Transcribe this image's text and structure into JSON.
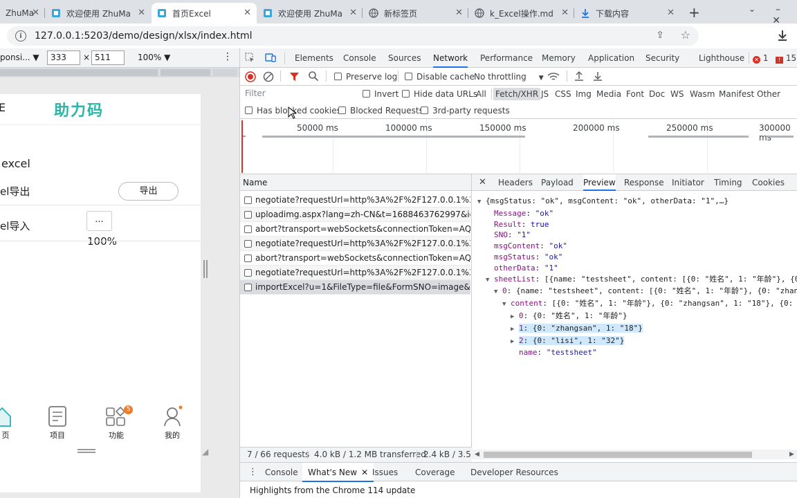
{
  "browser": {
    "tabs": [
      {
        "title": "ZhuMa",
        "icon": "app-icon",
        "active": false
      },
      {
        "title": "欢迎使用 ZhuMa",
        "icon": "app-icon",
        "active": false
      },
      {
        "title": "首页Excel",
        "icon": "app-icon",
        "active": true
      },
      {
        "title": "欢迎使用 ZhuMa",
        "icon": "app-icon",
        "active": false
      },
      {
        "title": "新标签页",
        "icon": "globe-icon",
        "active": false
      },
      {
        "title": "k_Excel操作.md",
        "icon": "globe-icon",
        "active": false
      },
      {
        "title": "下载内容",
        "icon": "download-icon",
        "active": false
      }
    ],
    "url": "127.0.0.1:5203/demo/design/xlsx/index.html"
  },
  "device_toolbar": {
    "mode": "ponsi...",
    "width": "333",
    "times": "×",
    "height": "511",
    "zoom": "100%"
  },
  "app": {
    "title_fragment": "E",
    "logo": "助力码",
    "section": "excel",
    "export_label": "el导出",
    "export_button": "导出",
    "import_label": "el导入",
    "import_button": "...",
    "progress": "100%",
    "nav": [
      {
        "label": "页",
        "icon": "home-icon"
      },
      {
        "label": "项目",
        "icon": "document-icon"
      },
      {
        "label": "功能",
        "icon": "grid-icon",
        "badge": "5"
      },
      {
        "label": "我的",
        "icon": "user-icon"
      }
    ]
  },
  "devtools": {
    "tabs": [
      "Elements",
      "Console",
      "Sources",
      "Network",
      "Performance",
      "Memory",
      "Application",
      "Security",
      "Lighthouse"
    ],
    "active_tab": "Network",
    "errors": "1",
    "warnings": "15",
    "preserve_log": "Preserve log",
    "disable_cache": "Disable cache",
    "throttling": "No throttling",
    "filter_placeholder": "Filter",
    "invert": "Invert",
    "hide_data_urls": "Hide data URLs",
    "type_filters": [
      "All",
      "Fetch/XHR",
      "JS",
      "CSS",
      "Img",
      "Media",
      "Font",
      "Doc",
      "WS",
      "Wasm",
      "Manifest",
      "Other"
    ],
    "active_filter": "Fetch/XHR",
    "blocked_cookies": "Has blocked cookies",
    "blocked_requests": "Blocked Requests",
    "third_party": "3rd-party requests",
    "timeline_ticks": [
      "50000 ms",
      "100000 ms",
      "150000 ms",
      "200000 ms",
      "250000 ms",
      "300000 ms"
    ],
    "name_header": "Name",
    "requests": [
      "negotiate?requestUrl=http%3A%2F%2F127.0.0.1%3A520...",
      "uploadimg.aspx?lang=zh-CN&t=1688463762997&id=d...",
      "abort?transport=webSockets&connectionToken=AQAA...",
      "negotiate?requestUrl=http%3A%2F%2F127.0.0.1%3A520...",
      "abort?transport=webSockets&connectionToken=AQAA...",
      "negotiate?requestUrl=http%3A%2F%2F127.0.0.1%3A520...",
      "importExcel?u=1&FileType=file&FormSNO=image&CdS..."
    ],
    "detail_tabs": [
      "Headers",
      "Payload",
      "Preview",
      "Response",
      "Initiator",
      "Timing",
      "Cookies"
    ],
    "active_detail_tab": "Preview",
    "preview": [
      {
        "indent": 0,
        "arrow": "▼",
        "key": "",
        "text": "{msgStatus: \"ok\", msgContent: \"ok\", otherData: \"1\",…}",
        "hl": false
      },
      {
        "indent": 1,
        "arrow": "",
        "key": "Message",
        "text": "\"ok\"",
        "hl": false
      },
      {
        "indent": 1,
        "arrow": "",
        "key": "Result",
        "text": "true",
        "hl": false
      },
      {
        "indent": 1,
        "arrow": "",
        "key": "SNO",
        "text": "\"1\"",
        "hl": false
      },
      {
        "indent": 1,
        "arrow": "",
        "key": "msgContent",
        "text": "\"ok\"",
        "hl": false
      },
      {
        "indent": 1,
        "arrow": "",
        "key": "msgStatus",
        "text": "\"ok\"",
        "hl": false
      },
      {
        "indent": 1,
        "arrow": "",
        "key": "otherData",
        "text": "\"1\"",
        "hl": false
      },
      {
        "indent": 1,
        "arrow": "▼",
        "key": "sheetList",
        "text": "[{name: \"testsheet\", content: [{0: \"姓名\", 1: \"年龄\"}, {0:",
        "hl": false
      },
      {
        "indent": 2,
        "arrow": "▼",
        "key": "0",
        "text": "{name: \"testsheet\", content: [{0: \"姓名\", 1: \"年龄\"}, {0: \"zhan",
        "hl": false
      },
      {
        "indent": 3,
        "arrow": "▼",
        "key": "content",
        "text": "[{0: \"姓名\", 1: \"年龄\"}, {0: \"zhangsan\", 1: \"18\"}, {0:",
        "hl": false
      },
      {
        "indent": 4,
        "arrow": "▶",
        "key": "0",
        "text": "{0: \"姓名\", 1: \"年龄\"}",
        "hl": false
      },
      {
        "indent": 4,
        "arrow": "▶",
        "key": "1",
        "text": "{0: \"zhangsan\", 1: \"18\"}",
        "hl": true
      },
      {
        "indent": 4,
        "arrow": "▶",
        "key": "2",
        "text": "{0: \"lisi\", 1: \"32\"}",
        "hl": true
      },
      {
        "indent": 4,
        "arrow": "",
        "key": "name",
        "text": "\"testsheet\"",
        "hl": false
      }
    ],
    "status_requests": "7 / 66 requests",
    "status_transferred": "4.0 kB / 1.2 MB transferred",
    "status_resources": "2.4 kB / 3.5 M",
    "drawer_tabs": [
      "Console",
      "What's New",
      "Issues",
      "Coverage",
      "Developer Resources"
    ],
    "active_drawer_tab": "What's New",
    "drawer_text": "Highlights from the Chrome 114 update"
  }
}
